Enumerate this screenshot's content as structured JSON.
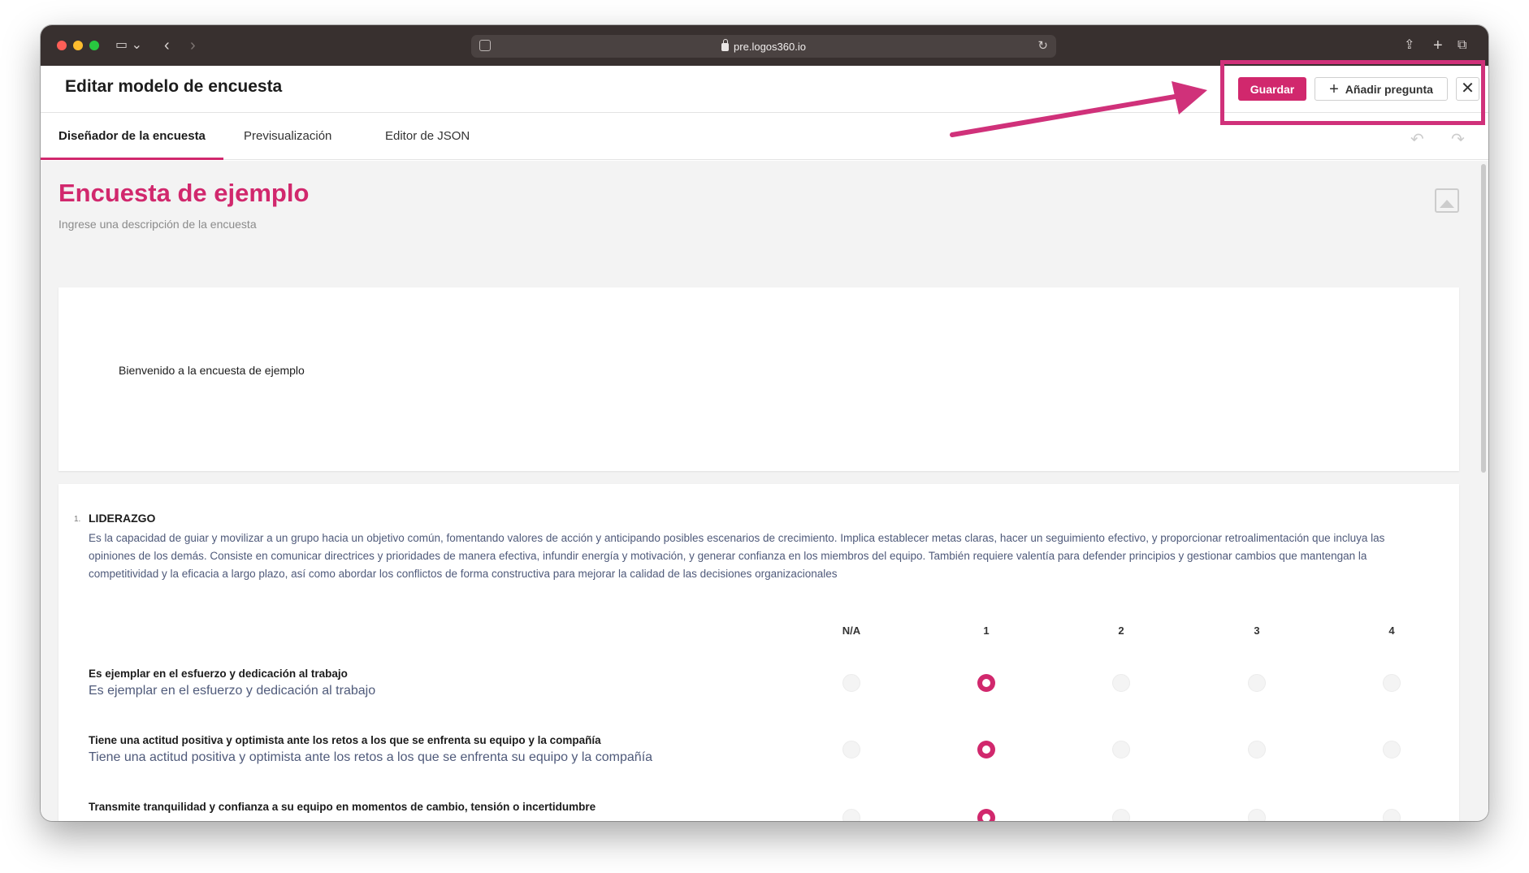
{
  "browser": {
    "url": "pre.logos360.io"
  },
  "header": {
    "title": "Editar modelo de encuesta",
    "save_label": "Guardar",
    "add_question_label": "Añadir pregunta",
    "close_glyph": "✕"
  },
  "tabs": [
    {
      "label": "Diseñador de la encuesta",
      "active": true
    },
    {
      "label": "Previsualización",
      "active": false
    },
    {
      "label": "Editor de JSON",
      "active": false
    }
  ],
  "survey": {
    "title": "Encuesta de ejemplo",
    "description_placeholder": "Ingrese una descripción de la encuesta",
    "welcome_text": "Bienvenido a la encuesta de ejemplo"
  },
  "question": {
    "number": "1.",
    "title": "LIDERAZGO",
    "description": "Es la capacidad de guiar y movilizar a un grupo hacia un objetivo común, fomentando valores de acción y anticipando posibles escenarios de crecimiento. Implica establecer metas claras, hacer un seguimiento efectivo, y proporcionar retroalimentación que incluya las opiniones de los demás. Consiste en comunicar directrices y prioridades de manera efectiva, infundir energía y motivación, y generar confianza en los miembros del equipo. También requiere valentía para defender principios y gestionar cambios que mantengan la competitividad y la eficacia a largo plazo, así como abordar los conflictos de forma constructiva para mejorar la calidad de las decisiones organizacionales",
    "columns": [
      "N/A",
      "1",
      "2",
      "3",
      "4"
    ],
    "rows": [
      {
        "label": "Es ejemplar en el esfuerzo y dedicación al trabajo",
        "sublabel": "Es ejemplar en el esfuerzo y dedicación al trabajo",
        "selected": "1"
      },
      {
        "label": "Tiene una actitud positiva y optimista ante los retos  a los que se enfrenta su equipo y  la compañía",
        "sublabel": "Tiene una actitud positiva y optimista ante los retos  a los que se enfrenta su equipo y  la compañía",
        "selected": "1"
      },
      {
        "label": "Transmite tranquilidad y confianza a su equipo en momentos de cambio, tensión o incertidumbre",
        "sublabel": "",
        "selected": "1"
      }
    ]
  },
  "colors": {
    "accent": "#d1286d",
    "annotation": "#d0317a"
  },
  "icons": [
    "sidebar-icon",
    "chevron-left-icon",
    "chevron-right-icon",
    "share-icon",
    "new-tab-icon",
    "tabs-overview-icon",
    "lock-icon",
    "reload-icon",
    "plus-icon",
    "close-icon",
    "undo-icon",
    "redo-icon",
    "image-placeholder-icon",
    "arrow-annotation"
  ]
}
